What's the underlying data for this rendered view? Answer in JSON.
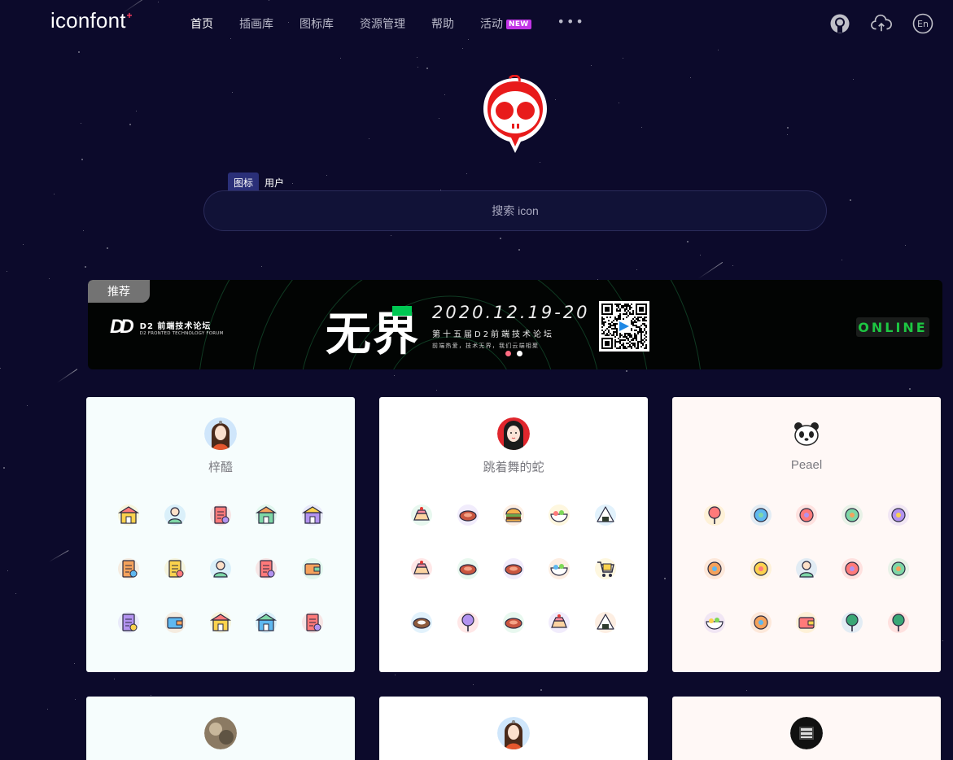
{
  "header": {
    "logo": "iconfont",
    "nav": [
      {
        "label": "首页",
        "active": true
      },
      {
        "label": "插画库"
      },
      {
        "label": "图标库"
      },
      {
        "label": "资源管理"
      },
      {
        "label": "帮助"
      },
      {
        "label": "活动",
        "badge": "NEW"
      }
    ],
    "more_label": "•••",
    "right_icons": [
      "github-icon",
      "upload-cloud-icon",
      "language-en-icon"
    ],
    "lang_label": "En"
  },
  "search": {
    "tabs": [
      "图标",
      "用户"
    ],
    "active_tab": 0,
    "placeholder": "搜索 icon"
  },
  "banner": {
    "tag": "推荐",
    "d2_title": "D2 前端技术论坛",
    "d2_subtitle": "D2 FRONTED TECHNOLOGY FORUM",
    "headline": "无界",
    "date": "2020.12.19-20",
    "forum": "第十五届D2前端技术论坛",
    "slogan": "前端热爱，技术无界，我们云端相聚",
    "online": "ONLINE",
    "slides": 2,
    "active_slide": 0
  },
  "colors": {
    "bg": "#0c0a2b",
    "accent_red": "#ff3e60",
    "badge_purple": "#c234e6",
    "online_green": "#1dc742"
  },
  "cards": [
    {
      "author": "梓醯",
      "bg": "cyan",
      "avatar": "avatar-woman-icon",
      "icons": [
        "store-icon",
        "delivery-person-icon",
        "map-icon",
        "shop-icon",
        "warehouse-icon",
        "document-share-icon",
        "receipt-icon",
        "doctor-icon",
        "clipboard-icon",
        "monitor-bag-icon",
        "shield-document-icon",
        "wallet-icon",
        "shopping-cart-icon",
        "building-globe-icon",
        "certificate-icon"
      ]
    },
    {
      "author": "跳着舞的蛇",
      "bg": "white",
      "avatar": "avatar-girl-icon",
      "icons": [
        "cake-icon",
        "steak-icon",
        "burger-icon",
        "noodle-bowl-icon",
        "dumpling-icon",
        "pudding-icon",
        "pizza-slice-icon",
        "sausage-icon",
        "salad-icon",
        "milk-carton-icon",
        "donut-icon",
        "lollipop-icon",
        "croissant-icon",
        "ice-cream-icon",
        "onigiri-icon"
      ]
    },
    {
      "author": "Peael",
      "bg": "pink",
      "avatar": "avatar-panda-icon",
      "icons": [
        "hot-air-balloon-icon",
        "bottle-icon",
        "hat-icon",
        "skewer-icon",
        "star-badge-icon",
        "tshirt-icon",
        "bird-icon",
        "snowman-icon",
        "sushi-icon",
        "eiffel-tower-icon",
        "hot-spring-icon",
        "sunrise-icon",
        "battery-icon",
        "tree-icon",
        "pine-tree-icon"
      ]
    },
    {
      "bg": "cyan",
      "avatar": "avatar-photo-icon"
    },
    {
      "bg": "white",
      "avatar": "avatar-woman-icon"
    },
    {
      "bg": "pink",
      "avatar": "avatar-dark-icon"
    }
  ]
}
